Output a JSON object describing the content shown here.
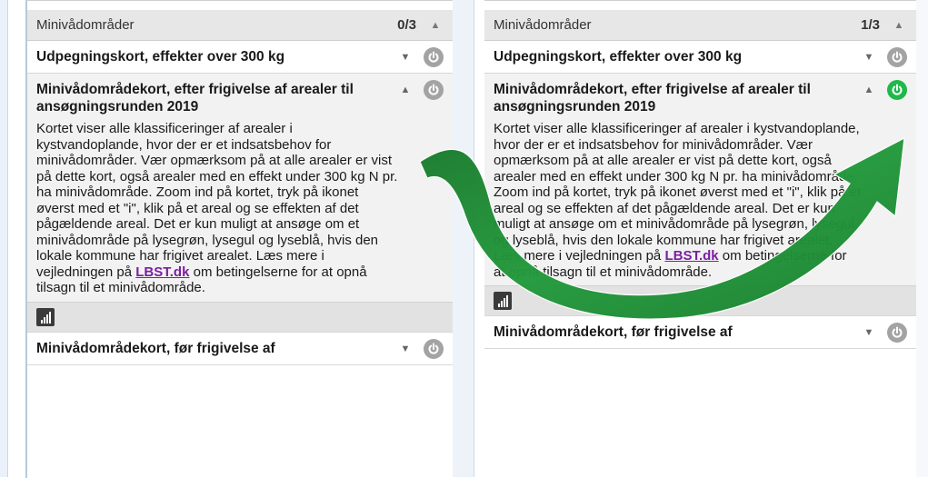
{
  "panels": [
    {
      "group_title": "Minivådområder",
      "group_count": "0/3",
      "layers": [
        {
          "title": "Udpegningskort, effekter over 300 kg",
          "state": "off"
        },
        {
          "title": "Minivådområdekort, efter frigivelse af arealer til ansøgningsrunden 2019",
          "state": "off"
        },
        {
          "title": "Minivådområdekort, før frigivelse af",
          "state": "off"
        }
      ]
    },
    {
      "group_title": "Minivådområder",
      "group_count": "1/3",
      "layers": [
        {
          "title": "Udpegningskort, effekter over 300 kg",
          "state": "off"
        },
        {
          "title": "Minivådområdekort, efter frigivelse af arealer til ansøgningsrunden 2019",
          "state": "on"
        },
        {
          "title": "Minivådområdekort, før frigivelse af",
          "state": "off"
        }
      ]
    }
  ],
  "description": {
    "before_link": "Kortet viser alle klassificeringer af arealer i kystvandoplande, hvor der er et indsatsbehov for minivådområder. Vær opmærksom på at alle arealer er vist på dette kort, også arealer med en effekt under 300 kg N pr. ha minivådområde. Zoom ind på kortet, tryk på ikonet øverst med et \"i\", klik på et areal og se effekten af det pågældende areal. Det er kun muligt at ansøge om et minivådområde på lysegrøn, lysegul og lyseblå, hvis den lokale kommune har frigivet arealet. Læs mere i vejledningen på ",
    "link": "LBST.dk",
    "after_link": " om betingelserne for at opnå tilsagn til et minivådområde."
  },
  "colors": {
    "power_off": "#a3a3a3",
    "power_on": "#1fb84a",
    "arrow_green": "#1e8a34",
    "link": "#7a1fa2"
  },
  "icons": {
    "power": "power-icon",
    "legend": "legend-bars-icon",
    "arrow": "curved-arrow"
  }
}
